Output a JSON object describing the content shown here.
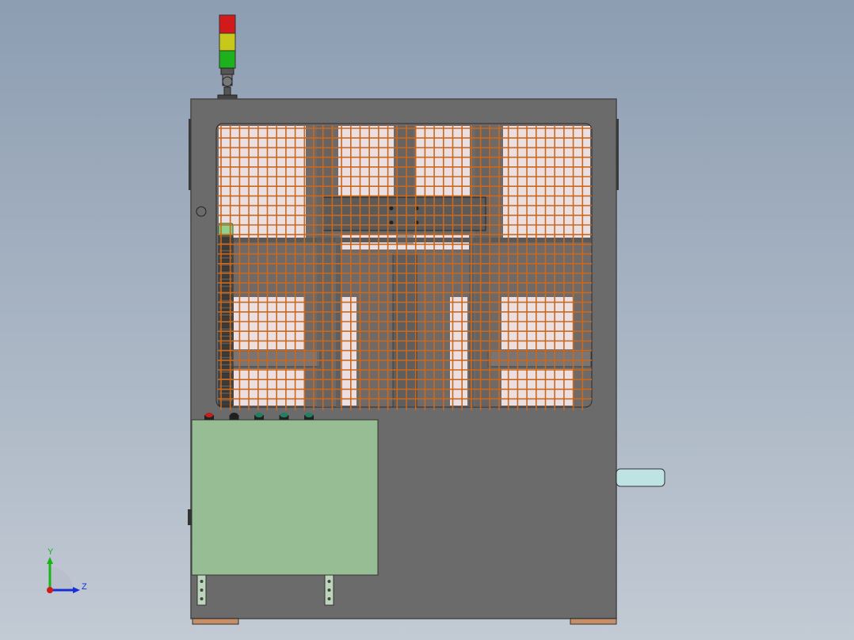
{
  "viewport": {
    "background_top": "#8d9db2",
    "background_bottom": "#c2cad4"
  },
  "colors": {
    "cabinet": "#6b6b6b",
    "cabinet_edge": "#2b2b2b",
    "mesh_wire": "#c8691f",
    "mesh_panel": "#ecdfe2",
    "control_panel": "#96bd94",
    "side_handle": "#bfe3e2",
    "feet": "#c58e67",
    "tower_red": "#d21a1a",
    "tower_yellow": "#c8c81a",
    "tower_green": "#1db21d"
  },
  "signal_tower": {
    "icon": "signal-tower-icon",
    "segments": [
      "red",
      "yellow",
      "green"
    ]
  },
  "control_buttons": {
    "icon": "push-button-icon",
    "colors": [
      "#c02020",
      "#202020",
      "#208060",
      "#208060",
      "#208060"
    ]
  },
  "triad": {
    "icon": "coordinate-triad-icon",
    "y_label": "Y",
    "z_label": "Z",
    "y_color": "#18b418",
    "z_color": "#1a2ed8",
    "x_color": "#d21a1a"
  }
}
